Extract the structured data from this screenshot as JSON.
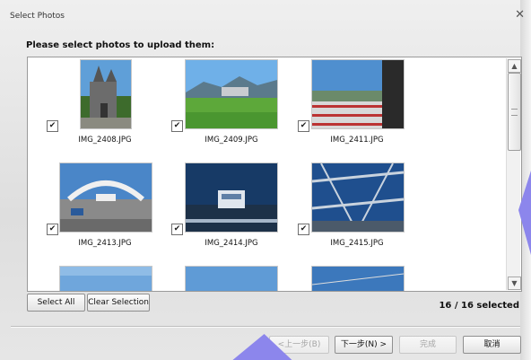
{
  "window": {
    "title": "Select Photos"
  },
  "instruction": "Please select photos to upload them:",
  "photos": [
    {
      "filename": "IMG_2408.JPG",
      "checked": true,
      "icon": "church-photo"
    },
    {
      "filename": "IMG_2409.JPG",
      "checked": true,
      "icon": "green-field-photo"
    },
    {
      "filename": "IMG_2411.JPG",
      "checked": true,
      "icon": "bridge-railing-photo"
    },
    {
      "filename": "IMG_2413.JPG",
      "checked": true,
      "icon": "white-bridge-photo"
    },
    {
      "filename": "IMG_2414.JPG",
      "checked": true,
      "icon": "bridge-dusk-photo"
    },
    {
      "filename": "IMG_2415.JPG",
      "checked": true,
      "icon": "bridge-cables-photo"
    }
  ],
  "check_mark": "✔",
  "buttons": {
    "select_all": "Select All",
    "clear_selection": "Clear Selection",
    "prev": "<上一步(B)",
    "next": "下一步(N) >",
    "finish": "完成",
    "cancel": "取消"
  },
  "selection_count": "16 / 16 selected",
  "colors": {
    "accent_blob": "#8c86ec"
  }
}
